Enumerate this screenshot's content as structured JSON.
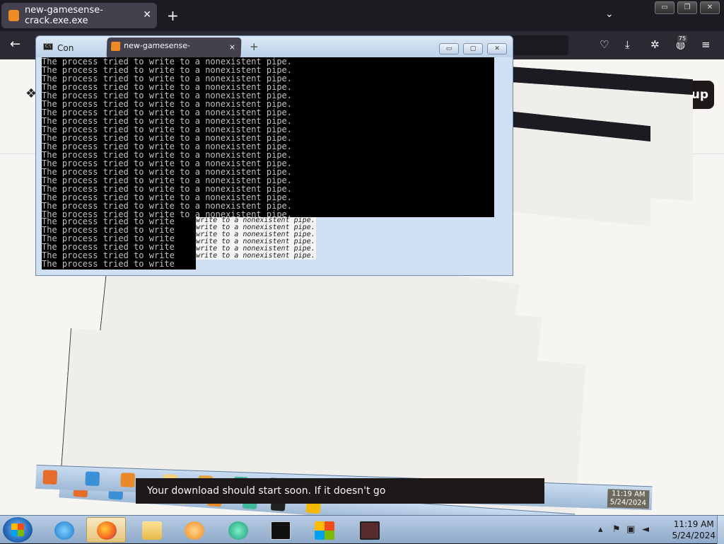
{
  "browser": {
    "tab_title": "new-gamesense-crack.exe.exe",
    "tab_close": "✕",
    "new_tab": "+",
    "list_tabs": "⌄",
    "back": "←",
    "nav_icons": [
      "pocket-icon",
      "download-icon",
      "extensions-icon",
      "account-icon",
      "menu-icon"
    ],
    "badge": "75"
  },
  "page": {
    "signup_text": "up",
    "download_message": "Your download should start soon. If it doesn't go"
  },
  "console": {
    "title": "Con",
    "overlay_tab_title": "new-gamesense-crack.exe.exe",
    "overlay_tab_close": "×",
    "overlay_plus": "+",
    "line": "The process tried to write to a nonexistent pipe.",
    "line_short": "The process tried to write",
    "ghost_line": "write to a nonexistent pipe."
  },
  "taskbar": {
    "clock_time": "11:19 AM",
    "clock_date": "5/24/2024",
    "apps": [
      "internet-explorer",
      "firefox",
      "file-explorer",
      "media-player",
      "app-green",
      "command-prompt",
      "windows-flag-app",
      "unknown-app"
    ]
  },
  "trail_clock": {
    "time": "11:19 AM",
    "date": "5/24/2024"
  },
  "colors": {
    "browser_dark": "#1c1b22",
    "page_bg": "#f7f5f2",
    "console_bg": "#000000",
    "console_text": "#c0c0c0",
    "taskbar": "#a9c2de",
    "dropbox_accent": "#f08a24"
  }
}
